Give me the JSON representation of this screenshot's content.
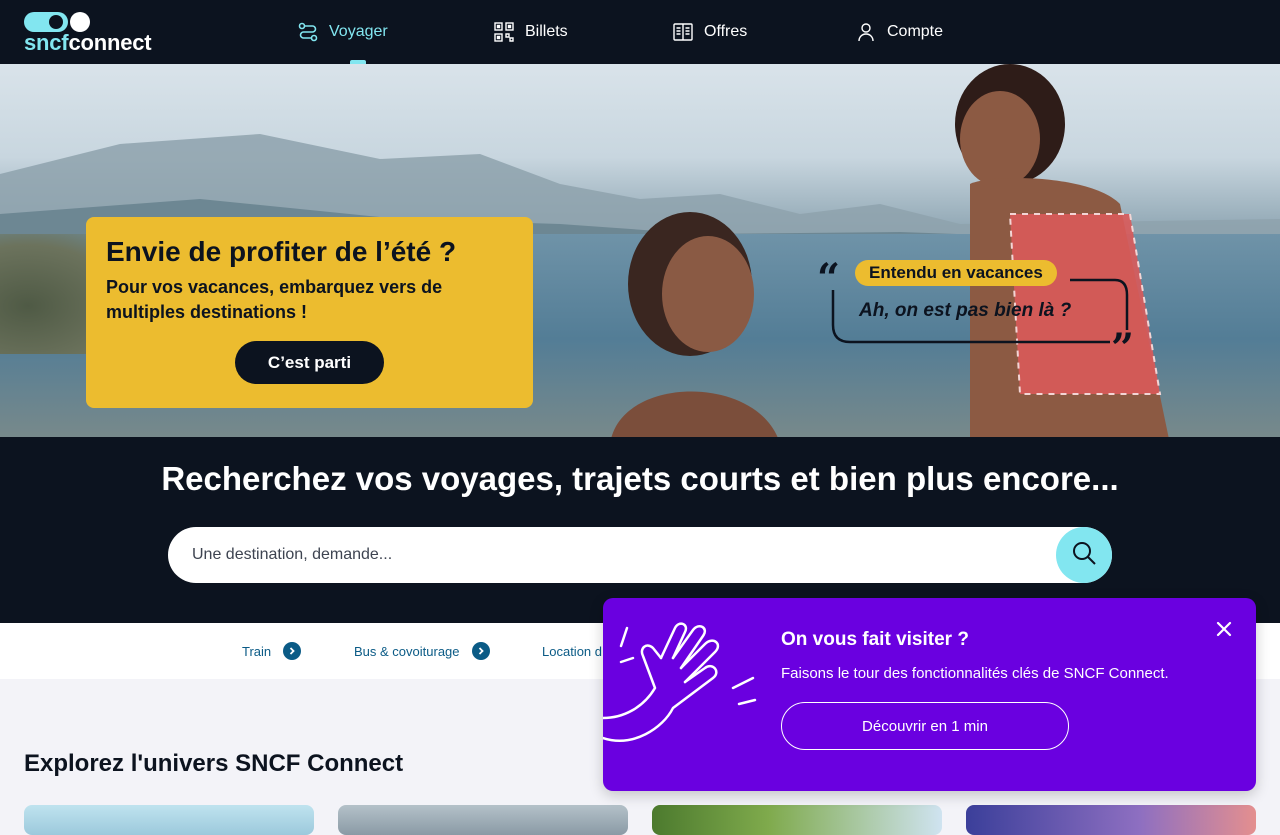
{
  "header": {
    "logo": {
      "part1": "sncf",
      "part2": "connect"
    },
    "nav": [
      {
        "label": "Voyager",
        "icon": "route-icon",
        "active": true
      },
      {
        "label": "Billets",
        "icon": "qr-code-icon"
      },
      {
        "label": "Offres",
        "icon": "open-book-icon"
      },
      {
        "label": "Compte",
        "icon": "user-icon"
      }
    ]
  },
  "hero": {
    "promo_title": "Envie de profiter de l’été ?",
    "promo_text": "Pour vos vacances, embarquez vers de multiples destinations !",
    "promo_button": "C’est parti",
    "quote_tag": "Entendu en vacances",
    "quote_text": "Ah, on est pas bien là ?"
  },
  "search": {
    "title": "Recherchez vos voyages, trajets courts et bien plus encore...",
    "placeholder": "Une destination, demande..."
  },
  "categories": [
    {
      "label": "Train"
    },
    {
      "label": "Bus & covoiturage"
    },
    {
      "label": "Location d"
    }
  ],
  "section": {
    "title": "Explorez l'univers SNCF Connect"
  },
  "tour": {
    "title": "On vous fait visiter ?",
    "text": "Faisons le tour des fonctionnalités clés de SNCF Connect.",
    "button": "Découvrir en 1 min"
  },
  "colors": {
    "header_bg": "#0c131f",
    "accent_cyan": "#82e6f0",
    "promo_yellow": "#ecbc2f",
    "tour_purple": "#6a00e0",
    "link_blue": "#0b5b86"
  }
}
